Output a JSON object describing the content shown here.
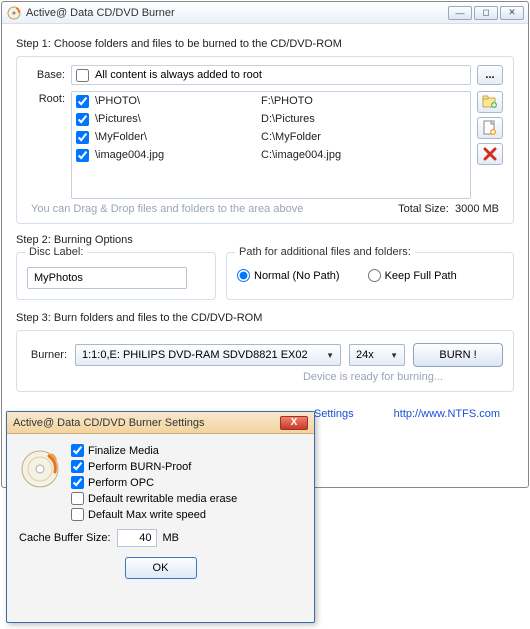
{
  "window": {
    "title": "Active@ Data CD/DVD Burner"
  },
  "step1": {
    "label": "Step 1: Choose folders and files to be burned to the CD/DVD-ROM",
    "base_label": "Base:",
    "base_text": "All content is always added to root",
    "root_label": "Root:",
    "items": [
      {
        "path": "\\PHOTO\\",
        "src": "F:\\PHOTO"
      },
      {
        "path": "\\Pictures\\",
        "src": "D:\\Pictures"
      },
      {
        "path": "\\MyFolder\\",
        "src": "C:\\MyFolder"
      },
      {
        "path": "\\image004.jpg",
        "src": "C:\\image004.jpg"
      }
    ],
    "hint": "You can Drag & Drop files and folders to the area above",
    "total_label": "Total Size:",
    "total_value": "3000 MB",
    "browse_btn": "..."
  },
  "step2": {
    "label": "Step 2: Burning Options",
    "disc_legend": "Disc Label:",
    "disc_value": "MyPhotos",
    "path_legend": "Path for additional files and folders:",
    "radio1": "Normal (No Path)",
    "radio2": "Keep Full Path"
  },
  "step3": {
    "label": "Step 3: Burn folders and files to the CD/DVD-ROM",
    "burner_label": "Burner:",
    "burner_sel": "1:1:0,E: PHILIPS  DVD-RAM SDVD8821 EX02",
    "speed": "24x",
    "burn": "BURN !",
    "ready": "Device is ready for burning..."
  },
  "footer": {
    "settings": "Settings",
    "url": "http://www.NTFS.com"
  },
  "settings_dlg": {
    "title": "Active@ Data CD/DVD Burner Settings",
    "opt1": "Finalize Media",
    "opt2": "Perform BURN-Proof",
    "opt3": "Perform OPC",
    "opt4": "Default rewritable media erase",
    "opt5": "Default Max write speed",
    "cache_label": "Cache Buffer Size:",
    "cache_value": "40",
    "cache_unit": "MB",
    "ok": "OK"
  }
}
